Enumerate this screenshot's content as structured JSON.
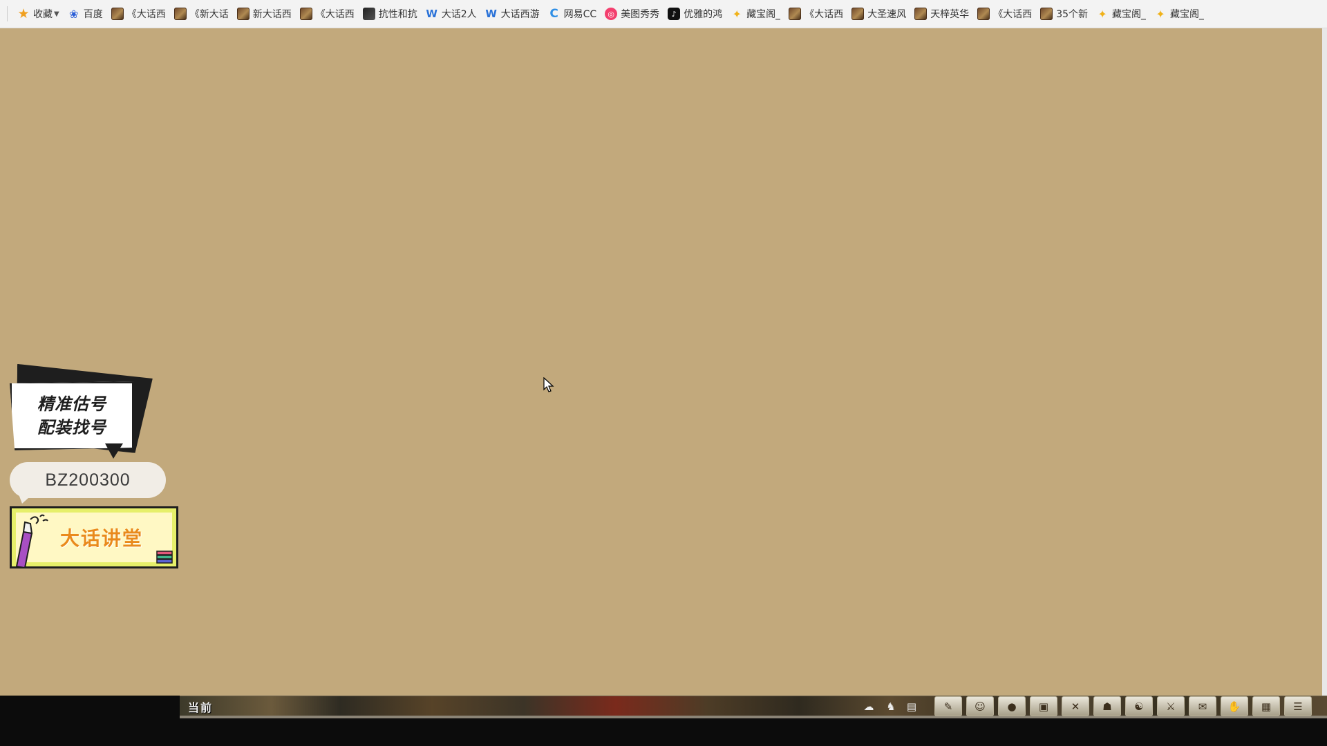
{
  "bookmarks": [
    {
      "icon": "star-icon",
      "label": "收藏",
      "has_dropdown": true
    },
    {
      "icon": "baidu-paw-icon",
      "label": "百度"
    },
    {
      "icon": "game-icon",
      "label": "《大话西"
    },
    {
      "icon": "game-icon",
      "label": "《新大话"
    },
    {
      "icon": "game-icon",
      "label": "新大话西"
    },
    {
      "icon": "game-icon",
      "label": "《大话西"
    },
    {
      "icon": "dark-game-icon",
      "label": "抗性和抗"
    },
    {
      "icon": "wing-icon",
      "label": "大话2人"
    },
    {
      "icon": "wing-icon",
      "label": "大话西游"
    },
    {
      "icon": "netease-cc-icon",
      "label": "网易CC"
    },
    {
      "icon": "meitu-icon",
      "label": "美图秀秀"
    },
    {
      "icon": "tiktok-icon",
      "label": "优雅的鸿"
    },
    {
      "icon": "cangbaoge-icon",
      "label": "藏宝阁_"
    },
    {
      "icon": "game-icon",
      "label": "《大话西"
    },
    {
      "icon": "game-icon",
      "label": "大圣速风"
    },
    {
      "icon": "game-icon",
      "label": "天梓英华"
    },
    {
      "icon": "game-icon",
      "label": "《大话西"
    },
    {
      "icon": "game-icon",
      "label": "35个新"
    },
    {
      "icon": "cangbaoge-icon",
      "label": "藏宝阁_"
    },
    {
      "icon": "cangbaoge-icon",
      "label": "藏宝阁_"
    }
  ],
  "ad": {
    "bubble_line1": "精准估号",
    "bubble_line2": "配装找号",
    "id_code": "BZ200300",
    "lecture_title": "大话讲堂"
  },
  "game_bar": {
    "current_label": "当前",
    "toolbar_icons": [
      "friends-icon",
      "team-icon",
      "chat-icon",
      "map-icon",
      "character-icon",
      "pet-icon",
      "item-icon",
      "skill-icon",
      "gang-icon",
      "taiji-icon",
      "weapon-icon",
      "task-icon",
      "system-icon",
      "calendar-icon",
      "menu-icon"
    ]
  },
  "colors": {
    "page_background": "#c2a97c",
    "bookmark_bar": "#f3f3f3",
    "lecture_text": "#e98a1c"
  }
}
